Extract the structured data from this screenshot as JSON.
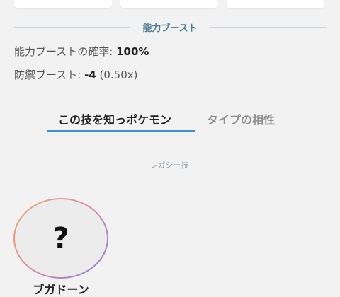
{
  "boost_section": {
    "title": "能力ブースト",
    "probability_label": "能力ブーストの確率: ",
    "probability_value": "100%",
    "defense_label": "防禦ブースト: ",
    "defense_value": "-4",
    "defense_multiplier": " (0.50x)"
  },
  "tabs": [
    {
      "label": "この技を知っポケモン",
      "active": true
    },
    {
      "label": "タイプの相性",
      "active": false
    }
  ],
  "legacy_section": {
    "title": "レガシー技"
  },
  "pokemon": [
    {
      "icon": "?",
      "name": "ブガドーン"
    }
  ],
  "colors": {
    "accent": "#3d8fd6",
    "section_title": "#4d7b99",
    "divider": "#c9d6e2"
  }
}
